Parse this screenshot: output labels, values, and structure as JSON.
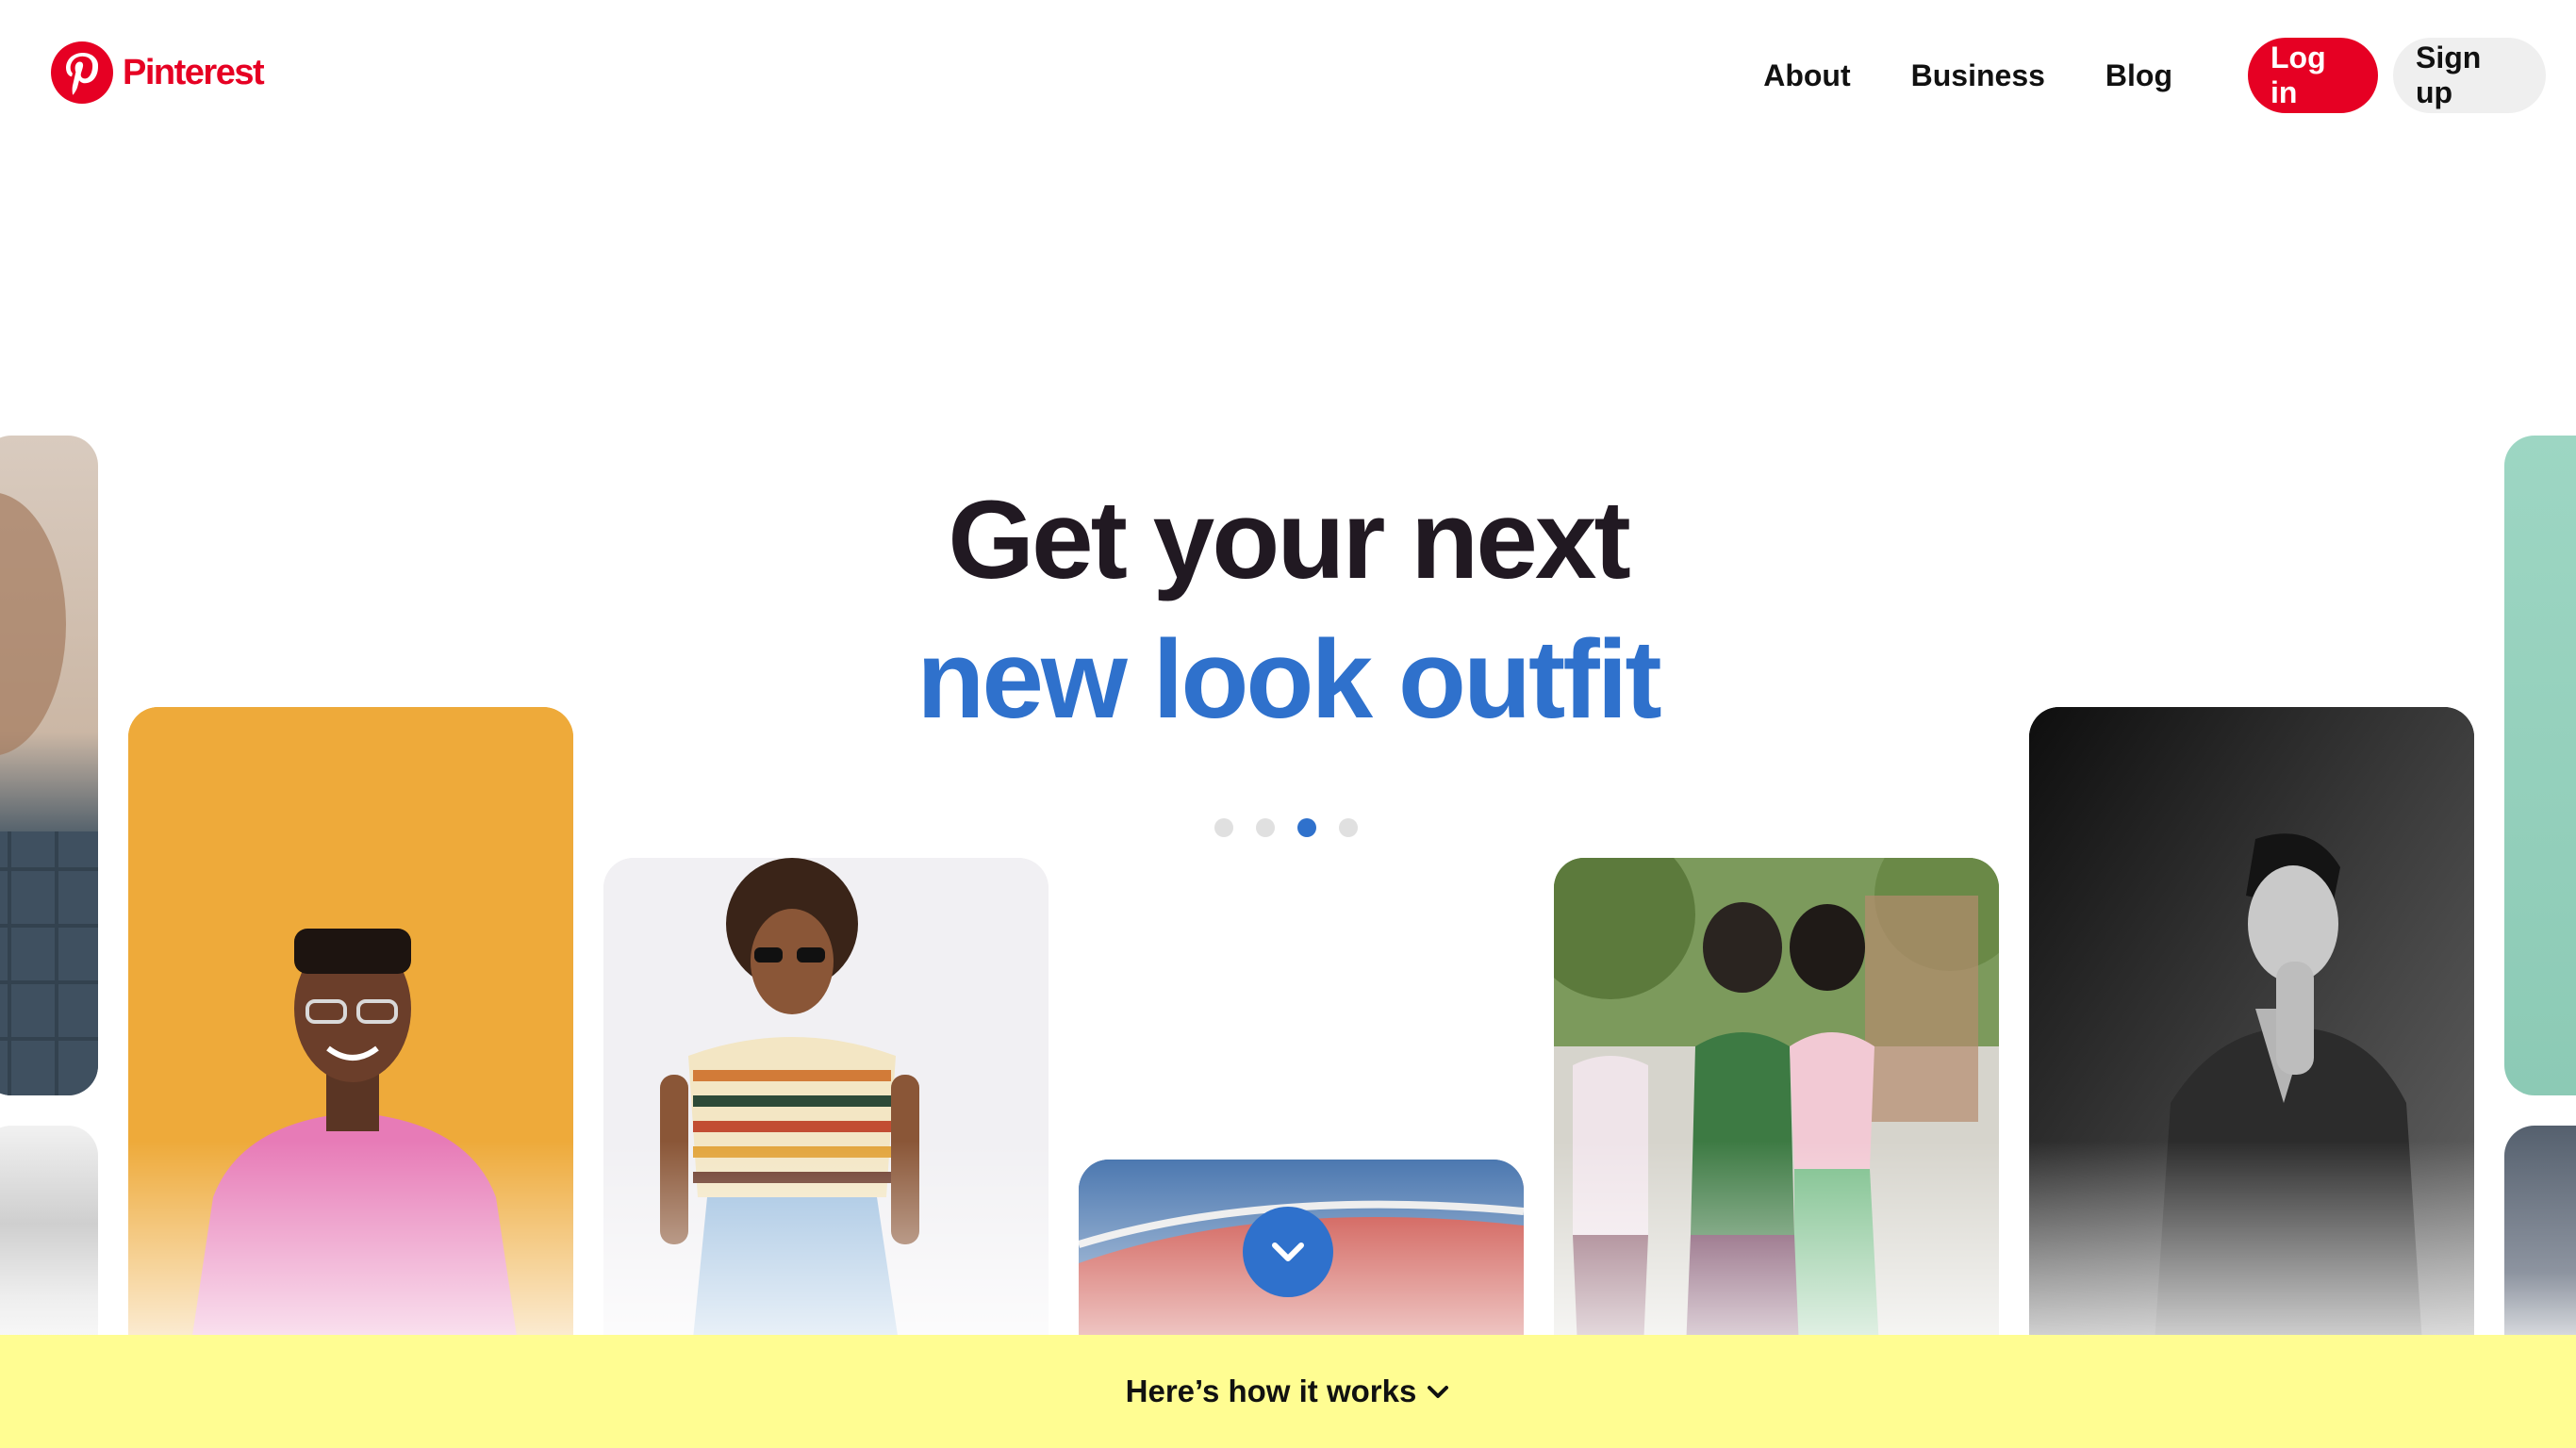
{
  "header": {
    "brand": "Pinterest",
    "nav": {
      "about": "About",
      "business": "Business",
      "blog": "Blog"
    },
    "login_label": "Log in",
    "signup_label": "Sign up"
  },
  "hero": {
    "title": "Get your next",
    "subtitle": "new look outfit",
    "carousel_dots": 4,
    "active_dot": 3
  },
  "banner": {
    "label": "Here’s how it works"
  },
  "icons": {
    "logo": "pinterest-logo-icon",
    "scroll": "chevron-down-icon",
    "banner": "chevron-down-icon"
  },
  "colors": {
    "brand_red": "#e60023",
    "accent_blue": "#2f71cc",
    "banner_yellow": "#fffd92",
    "title_dark": "#211922"
  }
}
